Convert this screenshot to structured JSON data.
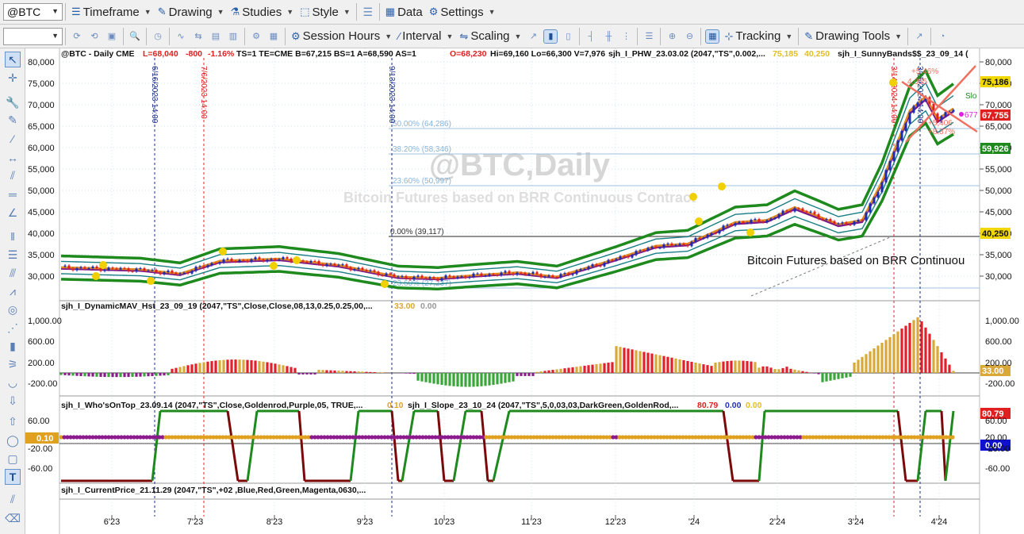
{
  "symbol_box": {
    "value": "@BTC"
  },
  "toolbar1": [
    {
      "label": "Timeframe",
      "icon": "list-icon"
    },
    {
      "label": "Drawing",
      "icon": "pencil-icon"
    },
    {
      "label": "Studies",
      "icon": "beaker-icon"
    },
    {
      "label": "Style",
      "icon": "style-icon"
    },
    {
      "label": "Data",
      "icon": "grid-icon"
    },
    {
      "label": "Settings",
      "icon": "gear-icon"
    }
  ],
  "toolbar2": [
    {
      "label": "Session Hours",
      "icon": "gear-icon"
    },
    {
      "label": "Interval",
      "icon": "chart-line-icon"
    },
    {
      "label": "Scaling",
      "icon": "scaling-icon"
    },
    {
      "label": "Tracking",
      "icon": "crosshair-icon"
    },
    {
      "label": "Drawing Tools",
      "icon": "pencil-icon"
    }
  ],
  "watermark": {
    "title": "@BTC,Daily",
    "subtitle": "Bitcoin Futures based on BRR Continuous Contract"
  },
  "price_header": {
    "symbol": "@BTC - Daily  CME",
    "last": "L=68,040",
    "change": "-800",
    "pct": "-1.16%",
    "rest": "TS=1  TE=CME  B=67,215  BS=1  A=68,590  AS=1",
    "open": "O=68,230",
    "hilo": "Hi=69,160  Lo=66,300  V=7,976",
    "study1": "sjh_I_PHW_23.03.02 (2047,\"TS\",0.002,...",
    "study1_v1": "75,185",
    "study1_v2": "40,250",
    "study2": "sjh_I_SunnyBands$$_23_09_14 ("
  },
  "date_labels": [
    "6/16/2023 14:00",
    "7/6/2023 14:00",
    "9/13/2023 14:00",
    "3/14/2024 14:00",
    "3/25/2024 14:00"
  ],
  "fib_labels": [
    "50.00% (64,286)",
    "38.20% (58,346)",
    "23.60% (50,997)",
    "0.00% (39,117)",
    "23.60% (27,237)"
  ],
  "trend_annotation": "Bitcoin Futures based on BRR Continuou",
  "right_notes": {
    "pct1": "+5.46%",
    "val1": "4,055",
    "val2": "+5,406",
    "pct2": "+8.87%",
    "tag": "677",
    "slope_label": "Slo"
  },
  "price_axis": [
    "80,000",
    "75,000",
    "70,000",
    "65,000",
    "60,000",
    "55,000",
    "50,000",
    "45,000",
    "40,000",
    "35,000",
    "30,000"
  ],
  "price_badges": [
    "75,186",
    "67,755",
    "59,926",
    "40,250"
  ],
  "pane2": {
    "label": "sjh_I_DynamicMAV_Hst_23_09_19 (2047,\"TS\",Close,Close,08,13,0.25,0.25,00,...",
    "v1": "33.00",
    "v2": "0.00",
    "axis": [
      "1,000.00",
      "600.00",
      "200.00",
      "-200.00"
    ],
    "badge": "33.00"
  },
  "pane3": {
    "label1": "sjh_I_Who'sOnTop_23.09.14 (2047,\"TS\",Close,Goldenrod,Purple,05,  TRUE,...",
    "v1": "0.10",
    "label2": "sjh_I_Slope_23_10_24 (2047,\"TS\",5,0,03,03,DarkGreen,GoldenRod,...",
    "v2": "80.79",
    "v3": "0.00",
    "v4": "0.00",
    "axis": [
      "60.00",
      "20.00",
      "-20.00",
      "-60.00"
    ],
    "badges": [
      "80.79",
      "0.00"
    ],
    "left_badge": "0.10"
  },
  "pane4": {
    "label": "sjh_I_CurrentPrice_21.11.29 (2047,\"TS\",+02 ,Blue,Red,Green,Magenta,0630,..."
  },
  "time_axis": [
    "6'23",
    "7'23",
    "8'23",
    "9'23",
    "10'23",
    "11'23",
    "12'23",
    "'24",
    "2'24",
    "3'24",
    "4'24"
  ],
  "colors": {
    "band_green": "#1e8a1e",
    "band_teal": "#1a7f86",
    "ma_orange": "#e08a1f",
    "ma_purple": "#7b1a8c",
    "hist_red": "#e0202a",
    "hist_gold": "#d8a838",
    "hist_green": "#3aa63a",
    "hist_purple": "#8b1a8c",
    "slope_green": "#1e8a1e",
    "slope_red": "#7a0a0a",
    "dot_purple": "#8b1a8c",
    "dot_gold": "#e0a020",
    "dot_yellow": "#f0d000"
  }
}
